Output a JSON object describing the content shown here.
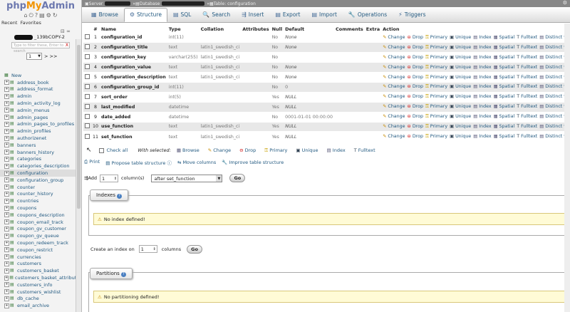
{
  "nav": {
    "logo": {
      "php": "php",
      "my": "My",
      "admin": "Admin"
    },
    "recent_label": "Recent",
    "favorites_label": "Favorites",
    "db_name": "_139bCOPY-2",
    "filter_placeholder": "Type to filter these, Enter to search",
    "filter_clear": "X",
    "page_select": "1",
    "page_next": "> >>",
    "new_label": "New",
    "tables": [
      "address_book",
      "address_format",
      "admin",
      "admin_activity_log",
      "admin_menus",
      "admin_pages",
      "admin_pages_to_profiles",
      "admin_profiles",
      "authorizenet",
      "banners",
      "banners_history",
      "categories",
      "categories_description",
      "configuration",
      "configuration_group",
      "counter",
      "counter_history",
      "countries",
      "coupons",
      "coupons_description",
      "coupon_email_track",
      "coupon_gv_customer",
      "coupon_gv_queue",
      "coupon_redeem_track",
      "coupon_restrict",
      "currencies",
      "customers",
      "customers_basket",
      "customers_basket_attribut",
      "customers_info",
      "customers_wishlist",
      "db_cache",
      "email_archive"
    ],
    "active_table": "configuration"
  },
  "breadcrumb": {
    "server": "Server",
    "db": "Database",
    "table": "Table: configuration"
  },
  "tabs": [
    {
      "label": "Browse",
      "icon": "▦"
    },
    {
      "label": "Structure",
      "icon": "⚙"
    },
    {
      "label": "SQL",
      "icon": "▤"
    },
    {
      "label": "Search",
      "icon": "🔍"
    },
    {
      "label": "Insert",
      "icon": "⇶"
    },
    {
      "label": "Export",
      "icon": "▤"
    },
    {
      "label": "Import",
      "icon": "▤"
    },
    {
      "label": "Operations",
      "icon": "🔧"
    },
    {
      "label": "Triggers",
      "icon": "⚡"
    }
  ],
  "active_tab": "Structure",
  "structure": {
    "headers": [
      "#",
      "Name",
      "Type",
      "Collation",
      "Attributes",
      "Null",
      "Default",
      "Comments",
      "Extra",
      "Action"
    ],
    "rows": [
      {
        "n": "1",
        "name": "configuration_id",
        "type": "int(11)",
        "collation": "",
        "attributes": "",
        "null": "No",
        "default": "None"
      },
      {
        "n": "2",
        "name": "configuration_title",
        "type": "text",
        "collation": "latin1_swedish_ci",
        "attributes": "",
        "null": "No",
        "default": "None"
      },
      {
        "n": "3",
        "name": "configuration_key",
        "type": "varchar(255)",
        "collation": "latin1_swedish_ci",
        "attributes": "",
        "null": "No",
        "default": ""
      },
      {
        "n": "4",
        "name": "configuration_value",
        "type": "text",
        "collation": "latin1_swedish_ci",
        "attributes": "",
        "null": "No",
        "default": "None"
      },
      {
        "n": "5",
        "name": "configuration_description",
        "type": "text",
        "collation": "latin1_swedish_ci",
        "attributes": "",
        "null": "No",
        "default": "None"
      },
      {
        "n": "6",
        "name": "configuration_group_id",
        "type": "int(11)",
        "collation": "",
        "attributes": "",
        "null": "No",
        "default": "0"
      },
      {
        "n": "7",
        "name": "sort_order",
        "type": "int(5)",
        "collation": "",
        "attributes": "",
        "null": "Yes",
        "default": "NULL"
      },
      {
        "n": "8",
        "name": "last_modified",
        "type": "datetime",
        "collation": "",
        "attributes": "",
        "null": "Yes",
        "default": "NULL"
      },
      {
        "n": "9",
        "name": "date_added",
        "type": "datetime",
        "collation": "",
        "attributes": "",
        "null": "No",
        "default": "0001-01-01 00:00:00"
      },
      {
        "n": "10",
        "name": "use_function",
        "type": "text",
        "collation": "latin1_swedish_ci",
        "attributes": "",
        "null": "Yes",
        "default": "NULL"
      },
      {
        "n": "11",
        "name": "set_function",
        "type": "text",
        "collation": "latin1_swedish_ci",
        "attributes": "",
        "null": "Yes",
        "default": "NULL"
      }
    ],
    "actions": [
      "Change",
      "Drop",
      "Primary",
      "Unique",
      "Index",
      "Spatial",
      "Fulltext",
      "Distinct values"
    ]
  },
  "bulk": {
    "check_all": "Check all",
    "with_selected": "With selected:",
    "buttons": [
      "Browse",
      "Change",
      "Drop",
      "Primary",
      "Unique",
      "Index",
      "Fulltext"
    ]
  },
  "links": {
    "print": "Print",
    "propose": "Propose table structure",
    "move": "Move columns",
    "improve": "Improve table structure"
  },
  "add": {
    "label": "Add",
    "count": "1",
    "columns_label": "column(s)",
    "position": "after set_function",
    "go": "Go"
  },
  "indexes": {
    "legend": "Indexes",
    "notice": "No index defined!"
  },
  "create_index": {
    "label": "Create an index on",
    "count": "1",
    "columns_label": "columns",
    "go": "Go"
  },
  "partitions": {
    "legend": "Partitions",
    "notice": "No partitioning defined!"
  }
}
